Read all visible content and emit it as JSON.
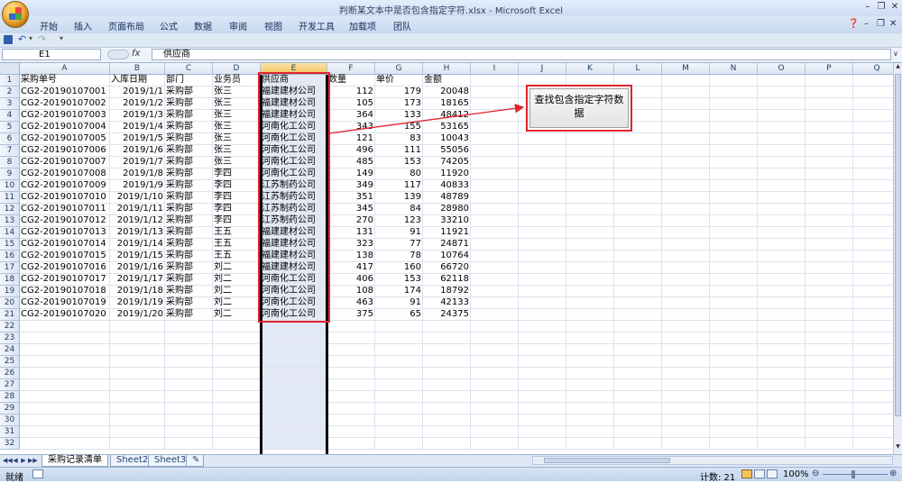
{
  "window": {
    "title": "判断某文本中是否包含指定字符.xlsx - Microsoft Excel"
  },
  "ribbon": {
    "tabs": [
      "开始",
      "插入",
      "页面布局",
      "公式",
      "数据",
      "审阅",
      "视图",
      "开发工具",
      "加载项",
      "团队"
    ]
  },
  "formula_bar": {
    "name_box": "E1",
    "fx_label": "fx",
    "formula": "供应商"
  },
  "columns": [
    "A",
    "B",
    "C",
    "D",
    "E",
    "F",
    "G",
    "H",
    "I",
    "J",
    "K",
    "L",
    "M",
    "N",
    "O",
    "P",
    "Q"
  ],
  "headers": [
    "采购单号",
    "入库日期",
    "部门",
    "业务员",
    "供应商",
    "数量",
    "单价",
    "金额"
  ],
  "rows": [
    [
      "CG2-20190107001",
      "2019/1/1",
      "采购部",
      "张三",
      "福建建材公司",
      "112",
      "179",
      "20048"
    ],
    [
      "CG2-20190107002",
      "2019/1/2",
      "采购部",
      "张三",
      "福建建材公司",
      "105",
      "173",
      "18165"
    ],
    [
      "CG2-20190107003",
      "2019/1/3",
      "采购部",
      "张三",
      "福建建材公司",
      "364",
      "133",
      "48412"
    ],
    [
      "CG2-20190107004",
      "2019/1/4",
      "采购部",
      "张三",
      "河南化工公司",
      "343",
      "155",
      "53165"
    ],
    [
      "CG2-20190107005",
      "2019/1/5",
      "采购部",
      "张三",
      "河南化工公司",
      "121",
      "83",
      "10043"
    ],
    [
      "CG2-20190107006",
      "2019/1/6",
      "采购部",
      "张三",
      "河南化工公司",
      "496",
      "111",
      "55056"
    ],
    [
      "CG2-20190107007",
      "2019/1/7",
      "采购部",
      "张三",
      "河南化工公司",
      "485",
      "153",
      "74205"
    ],
    [
      "CG2-20190107008",
      "2019/1/8",
      "采购部",
      "李四",
      "河南化工公司",
      "149",
      "80",
      "11920"
    ],
    [
      "CG2-20190107009",
      "2019/1/9",
      "采购部",
      "李四",
      "江苏制药公司",
      "349",
      "117",
      "40833"
    ],
    [
      "CG2-20190107010",
      "2019/1/10",
      "采购部",
      "李四",
      "江苏制药公司",
      "351",
      "139",
      "48789"
    ],
    [
      "CG2-20190107011",
      "2019/1/11",
      "采购部",
      "李四",
      "江苏制药公司",
      "345",
      "84",
      "28980"
    ],
    [
      "CG2-20190107012",
      "2019/1/12",
      "采购部",
      "李四",
      "江苏制药公司",
      "270",
      "123",
      "33210"
    ],
    [
      "CG2-20190107013",
      "2019/1/13",
      "采购部",
      "王五",
      "福建建材公司",
      "131",
      "91",
      "11921"
    ],
    [
      "CG2-20190107014",
      "2019/1/14",
      "采购部",
      "王五",
      "福建建材公司",
      "323",
      "77",
      "24871"
    ],
    [
      "CG2-20190107015",
      "2019/1/15",
      "采购部",
      "王五",
      "福建建材公司",
      "138",
      "78",
      "10764"
    ],
    [
      "CG2-20190107016",
      "2019/1/16",
      "采购部",
      "刘二",
      "福建建材公司",
      "417",
      "160",
      "66720"
    ],
    [
      "CG2-20190107017",
      "2019/1/17",
      "采购部",
      "刘二",
      "河南化工公司",
      "406",
      "153",
      "62118"
    ],
    [
      "CG2-20190107018",
      "2019/1/18",
      "采购部",
      "刘二",
      "河南化工公司",
      "108",
      "174",
      "18792"
    ],
    [
      "CG2-20190107019",
      "2019/1/19",
      "采购部",
      "刘二",
      "河南化工公司",
      "463",
      "91",
      "42133"
    ],
    [
      "CG2-20190107020",
      "2019/1/20",
      "采购部",
      "刘二",
      "河南化工公司",
      "375",
      "65",
      "24375"
    ]
  ],
  "macro_button": {
    "label": "查找包含指定字符数据"
  },
  "sheets": [
    "采购记录清单",
    "Sheet2",
    "Sheet3"
  ],
  "status": {
    "mode": "就绪",
    "count": "计数: 21",
    "zoom": "100%"
  },
  "colors": {
    "highlight": "#e0242b",
    "selected_column": "#e3e9f4"
  }
}
